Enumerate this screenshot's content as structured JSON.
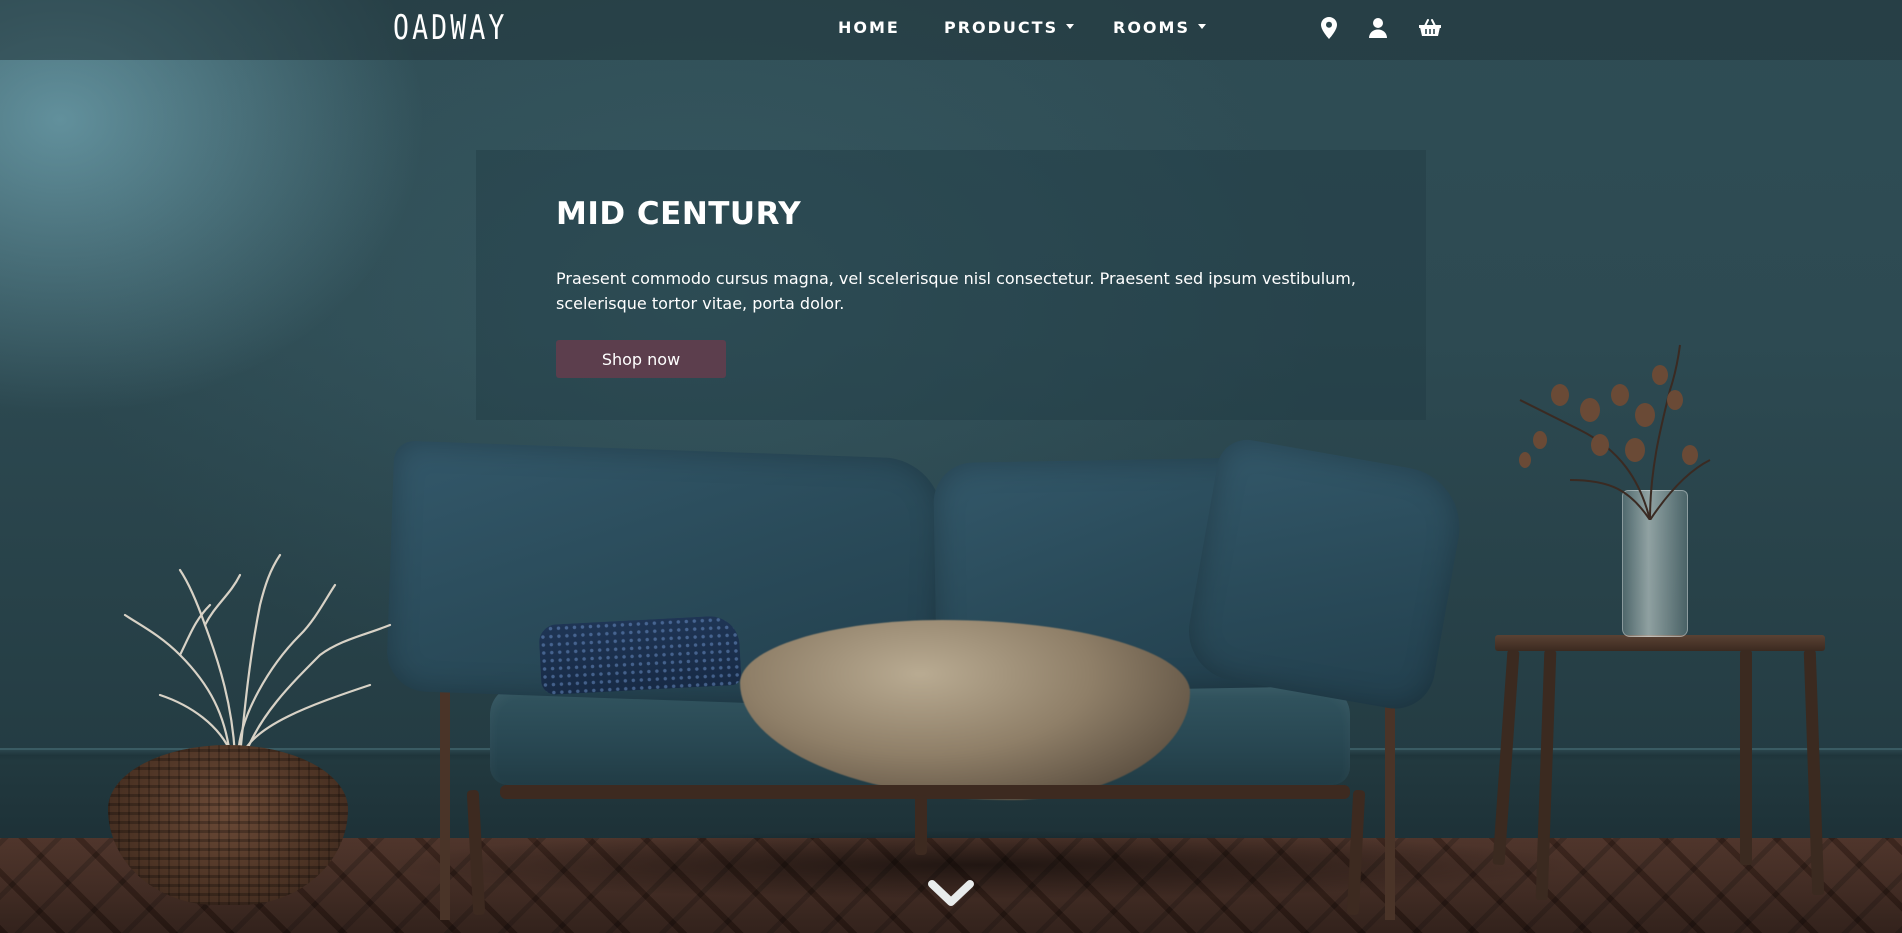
{
  "header": {
    "logo": "OADWAY",
    "nav": [
      {
        "label": "HOME",
        "dropdown": false
      },
      {
        "label": "PRODUCTS",
        "dropdown": true
      },
      {
        "label": "ROOMS",
        "dropdown": true
      }
    ],
    "icons": [
      "map-pin-icon",
      "user-icon",
      "shopping-basket-icon"
    ]
  },
  "hero": {
    "title": "MID CENTURY",
    "text": "Praesent commodo cursus magna, vel scelerisque nisl consectetur. Praesent sed ipsum vestibulum, scelerisque tortor vitae, porta dolor.",
    "cta_label": "Shop now",
    "background": "photo-living-room-teal-wall-sofa",
    "scroll_icon": "chevron-down-icon"
  },
  "colors": {
    "wall": "#2d4a52",
    "header_bg": "#20343a",
    "button_bg": "#5c3e4d",
    "text": "#ffffff"
  }
}
